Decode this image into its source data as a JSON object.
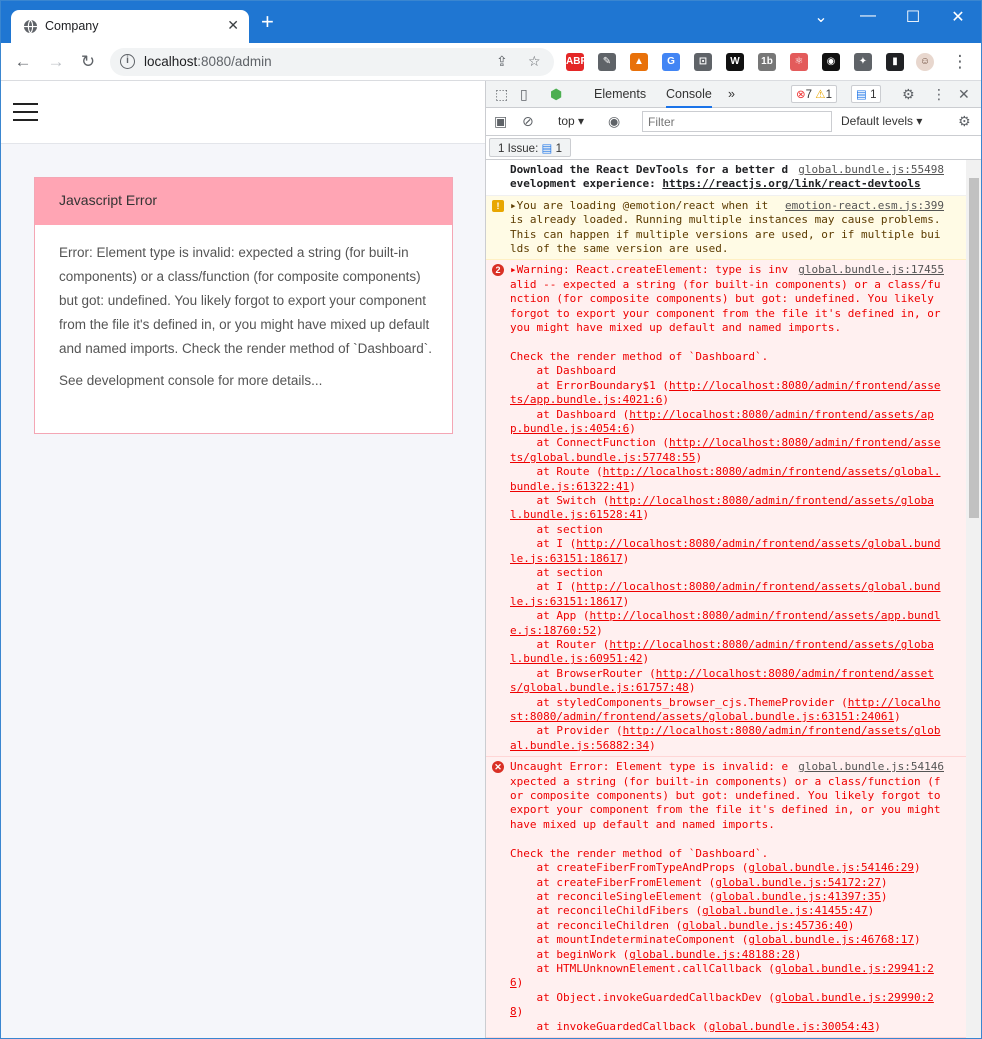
{
  "tab": {
    "title": "Company",
    "close": "✕",
    "new": "+"
  },
  "window": {
    "minimize": "—",
    "maximize": "☐",
    "close": "✕",
    "chevron": "⌄"
  },
  "toolbar": {
    "url_host": "localhost",
    "url_path": ":8080/admin"
  },
  "extensions": [
    {
      "name": "ABP",
      "label": "ABP",
      "color": "#e42727"
    },
    {
      "name": "eyedropper",
      "label": "✎",
      "color": "#5f6368"
    },
    {
      "name": "colorzilla",
      "label": "▲",
      "color": "#e8710a"
    },
    {
      "name": "translate",
      "label": "G",
      "color": "#4285f4"
    },
    {
      "name": "screenshot",
      "label": "⊡",
      "color": "#5f6368"
    },
    {
      "name": "wikipedia",
      "label": "W",
      "color": "#111111"
    },
    {
      "name": "1b",
      "label": "1b",
      "color": "#777777"
    },
    {
      "name": "react",
      "label": "⚛",
      "color": "#e35b5b"
    },
    {
      "name": "darkmode",
      "label": "◉",
      "color": "#111111"
    },
    {
      "name": "puzzle",
      "label": "✦",
      "color": "#5f6368"
    },
    {
      "name": "sidepanel",
      "label": "▮",
      "color": "#202124"
    }
  ],
  "page": {
    "error_title": "Javascript Error",
    "error_message": "Error: Element type is invalid: expected a string (for built-in components) or a class/function (for composite components) but got: undefined. You likely forgot to export your component from the file it's defined in, or you might have mixed up default and named imports. Check the render method of `Dashboard`.",
    "error_hint": "See development console for more details..."
  },
  "devtools": {
    "tabs": [
      "Elements",
      "Console"
    ],
    "active_tab": "Console",
    "more": "»",
    "error_count": "7",
    "warn_count": "1",
    "msg_count": "1",
    "context": "top",
    "filter_placeholder": "Filter",
    "levels": "Default levels",
    "issue_label": "1 Issue:",
    "issue_count": "1",
    "messages": {
      "m1_src": "global.bundle.js:55498",
      "m1_text": "Download the React DevTools for a better development experience: ",
      "m1_link": "https://reactjs.org/link/react-devtools",
      "m2_src": "emotion-react.esm.js:399",
      "m2_text": "You are loading @emotion/react when it is already loaded. Running multiple instances may cause problems. This can happen if multiple versions are used, or if multiple builds of the same version are used.",
      "m3_badge": "2",
      "m3_src": "global.bundle.js:17455",
      "m3_text": "Warning: React.createElement: type is invalid -- expected a string (for built-in components) or a class/function (for composite components) but got: undefined. You likely forgot to export your component from the file it's defined in, or you might have mixed up default and named imports.\n\nCheck the render method of `Dashboard`.",
      "m3_stack": [
        {
          "fn": "    at Dashboard",
          "link": ""
        },
        {
          "fn": "    at ErrorBoundary$1 (",
          "link": "http://localhost:8080/admin/frontend/assets/app.bundle.js:4021:6"
        },
        {
          "fn": "    at Dashboard (",
          "link": "http://localhost:8080/admin/frontend/assets/app.bundle.js:4054:6"
        },
        {
          "fn": "    at ConnectFunction (",
          "link": "http://localhost:8080/admin/frontend/assets/global.bundle.js:57748:55"
        },
        {
          "fn": "    at Route (",
          "link": "http://localhost:8080/admin/frontend/assets/global.bundle.js:61322:41"
        },
        {
          "fn": "    at Switch (",
          "link": "http://localhost:8080/admin/frontend/assets/global.bundle.js:61528:41"
        },
        {
          "fn": "    at section",
          "link": ""
        },
        {
          "fn": "    at I (",
          "link": "http://localhost:8080/admin/frontend/assets/global.bundle.js:63151:18617"
        },
        {
          "fn": "    at section",
          "link": ""
        },
        {
          "fn": "    at I (",
          "link": "http://localhost:8080/admin/frontend/assets/global.bundle.js:63151:18617"
        },
        {
          "fn": "    at App (",
          "link": "http://localhost:8080/admin/frontend/assets/app.bundle.js:18760:52"
        },
        {
          "fn": "    at Router (",
          "link": "http://localhost:8080/admin/frontend/assets/global.bundle.js:60951:42"
        },
        {
          "fn": "    at BrowserRouter (",
          "link": "http://localhost:8080/admin/frontend/assets/global.bundle.js:61757:48"
        },
        {
          "fn": "    at styledComponents_browser_cjs.ThemeProvider (",
          "link": "http://localhost:8080/admin/frontend/assets/global.bundle.js:63151:24061"
        },
        {
          "fn": "    at Provider (",
          "link": "http://localhost:8080/admin/frontend/assets/global.bundle.js:56882:34"
        }
      ],
      "m4_src": "global.bundle.js:54146",
      "m4_text": "Uncaught Error: Element type is invalid: expected a string (for built-in components) or a class/function (for composite components) but got: undefined. You likely forgot to export your component from the file it's defined in, or you might have mixed up default and named imports.\n\nCheck the render method of `Dashboard`.",
      "m4_stack": [
        {
          "fn": "    at createFiberFromTypeAndProps (",
          "link": "global.bundle.js:54146:29"
        },
        {
          "fn": "    at createFiberFromElement (",
          "link": "global.bundle.js:54172:27"
        },
        {
          "fn": "    at reconcileSingleElement (",
          "link": "global.bundle.js:41397:35"
        },
        {
          "fn": "    at reconcileChildFibers (",
          "link": "global.bundle.js:41455:47"
        },
        {
          "fn": "    at reconcileChildren (",
          "link": "global.bundle.js:45736:40"
        },
        {
          "fn": "    at mountIndeterminateComponent (",
          "link": "global.bundle.js:46768:17"
        },
        {
          "fn": "    at beginWork (",
          "link": "global.bundle.js:48188:28"
        },
        {
          "fn": "    at HTMLUnknownElement.callCallback (",
          "link": "global.bundle.js:29941:26"
        },
        {
          "fn": "    at Object.invokeGuardedCallbackDev (",
          "link": "global.bundle.js:29990:28"
        },
        {
          "fn": "    at invokeGuardedCallback (",
          "link": "global.bundle.js:30054:43"
        }
      ]
    }
  }
}
